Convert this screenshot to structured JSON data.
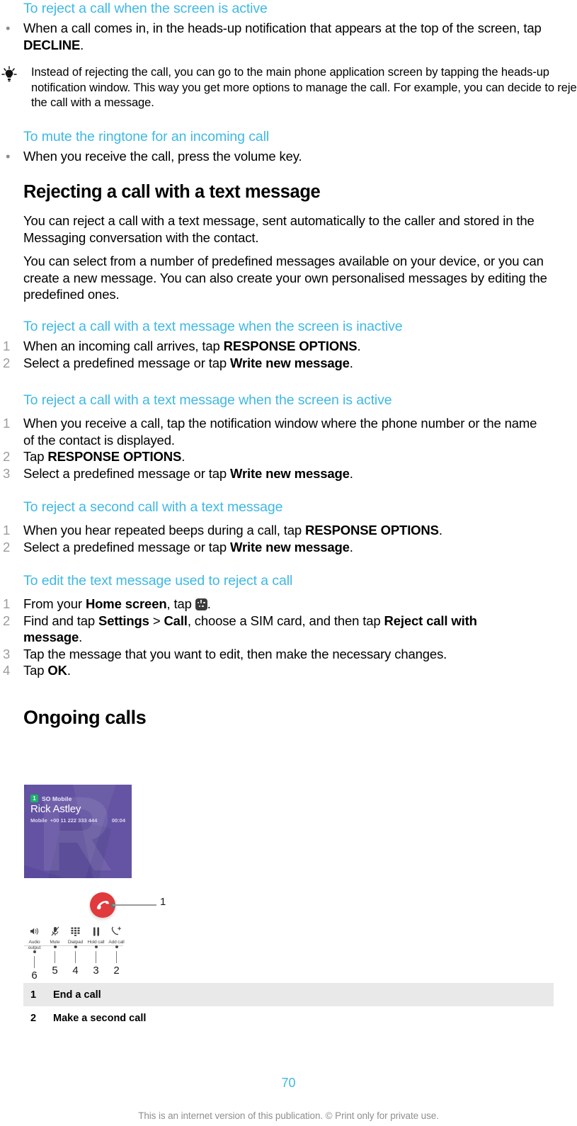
{
  "colors": {
    "heading_cyan": "#3fb8e4",
    "list_number_gray": "#9c9c9c",
    "phone_purple": "#5b4a9e",
    "end_call_red": "#e03a3c",
    "sim_badge_green": "#19b36b",
    "table_shade": "#e9e9e9",
    "footer_gray": "#8f8f8f"
  },
  "sections": [
    {
      "heading": "To reject a call when the screen is active",
      "bullets": [
        {
          "pre": "When a call comes in, in the heads-up notification that appears at the top of the screen, tap ",
          "bold": "DECLINE",
          "post": "."
        }
      ]
    }
  ],
  "tip": {
    "icon": "lightbulb-icon",
    "text": "Instead of rejecting the call, you can go to the main phone application screen by tapping the heads-up notification window. This way you get more options to manage the call. For example, you can decide to reject the call with a message."
  },
  "mute_section": {
    "heading": "To mute the ringtone for an incoming call",
    "bullet": "When you receive the call, press the volume key."
  },
  "reject_text_section": {
    "heading": "Rejecting a call with a text message",
    "para1": "You can reject a call with a text message, sent automatically to the caller and stored in the Messaging conversation with the contact.",
    "para2": "You can select from a number of predefined messages available on your device, or you can create a new message. You can also create your own personalised messages by editing the predefined ones."
  },
  "proc_inactive": {
    "heading": "To reject a call with a text message when the screen is inactive",
    "steps": [
      {
        "num": "1",
        "pre": "When an incoming call arrives, tap ",
        "bold": "RESPONSE OPTIONS",
        "post": "."
      },
      {
        "num": "2",
        "pre": "Select a predefined message or tap ",
        "bold": "Write new message",
        "post": "."
      }
    ]
  },
  "proc_active": {
    "heading": "To reject a call with a text message when the screen is active",
    "steps": [
      {
        "num": "1",
        "pre": "When you receive a call, tap the notification window where the phone number or the name of the contact is displayed.",
        "bold": "",
        "post": ""
      },
      {
        "num": "2",
        "pre": "Tap ",
        "bold": "RESPONSE OPTIONS",
        "post": "."
      },
      {
        "num": "3",
        "pre": "Select a predefined message or tap ",
        "bold": "Write new message",
        "post": "."
      }
    ]
  },
  "proc_second": {
    "heading": "To reject a second call with a text message",
    "steps": [
      {
        "num": "1",
        "pre": "When you hear repeated beeps during a call, tap ",
        "bold": "RESPONSE OPTIONS",
        "post": "."
      },
      {
        "num": "2",
        "pre": "Select a predefined message or tap ",
        "bold": "Write new message",
        "post": "."
      }
    ]
  },
  "proc_edit": {
    "heading": "To edit the text message used to reject a call",
    "steps": [
      {
        "num": "1",
        "pre": "From your ",
        "bold": "Home screen",
        "post": ", tap ",
        "icon": "app-drawer-icon",
        "post2": "."
      },
      {
        "num": "2",
        "pre": "Find and tap ",
        "bold": "Settings",
        "mid1": " > ",
        "bold2": "Call",
        "mid2": ", choose a SIM card, and then tap ",
        "bold3": "Reject call with message",
        "post": "."
      },
      {
        "num": "3",
        "pre": "Tap the message that you want to edit, then make the necessary changes.",
        "bold": "",
        "post": ""
      },
      {
        "num": "4",
        "pre": "Tap ",
        "bold": "OK",
        "post": "."
      }
    ]
  },
  "ongoing": {
    "heading": "Ongoing calls"
  },
  "phone_screen": {
    "sim_badge": "1",
    "operator": "SO Mobile",
    "caller_name": "Rick Astley",
    "number_label": "Mobile",
    "number": "+00 11 222 333 444",
    "timer": "00:04",
    "watermark": "R"
  },
  "diagram": {
    "end_call_callout": "1",
    "end_call_icon": "end-call-icon",
    "controls": [
      {
        "icon": "speaker-icon",
        "label": "Audio output",
        "callout": "6"
      },
      {
        "icon": "mute-icon",
        "label": "Mute",
        "callout": "5"
      },
      {
        "icon": "dialpad-icon",
        "label": "Dialpad",
        "callout": "4"
      },
      {
        "icon": "hold-icon",
        "label": "Hold call",
        "callout": "3"
      },
      {
        "icon": "add-call-icon",
        "label": "Add call",
        "callout": "2"
      }
    ]
  },
  "legend": {
    "rows": [
      {
        "num": "1",
        "text": "End a call"
      },
      {
        "num": "2",
        "text": "Make a second call"
      }
    ]
  },
  "footer": {
    "page_number": "70",
    "notice": "This is an internet version of this publication. © Print only for private use."
  }
}
